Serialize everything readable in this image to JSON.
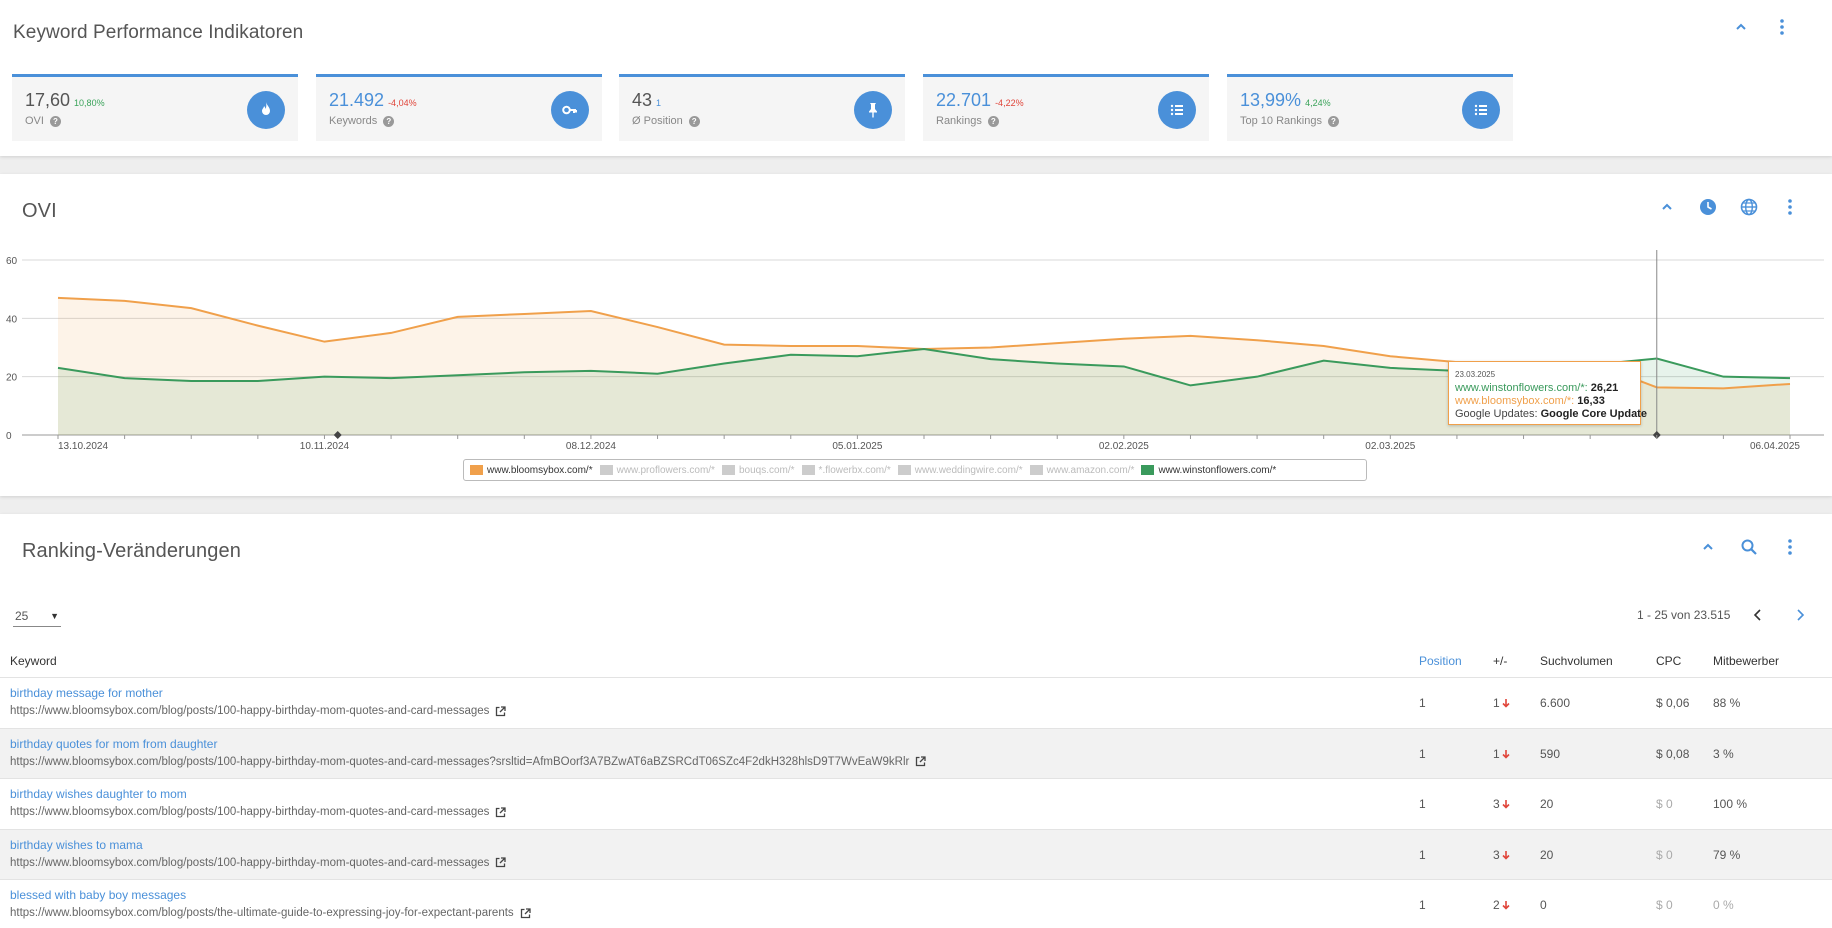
{
  "kpi_section": {
    "title": "Keyword Performance Indikatoren",
    "cards": [
      {
        "value": "17,60",
        "change": "10,80%",
        "change_type": "pos",
        "label": "OVI",
        "icon": "flame-icon",
        "value_blue": false
      },
      {
        "value": "21.492",
        "change": "-4,04%",
        "change_type": "neg",
        "label": "Keywords",
        "icon": "key-icon",
        "value_blue": true
      },
      {
        "value": "43",
        "change": "1",
        "change_type": "blue",
        "label": "Ø Position",
        "icon": "pin-icon",
        "value_blue": false
      },
      {
        "value": "22.701",
        "change": "-4,22%",
        "change_type": "neg",
        "label": "Rankings",
        "icon": "list-icon",
        "value_blue": true
      },
      {
        "value": "13,99%",
        "change": "4,24%",
        "change_type": "pos",
        "label": "Top 10 Rankings",
        "icon": "list-icon",
        "value_blue": true
      }
    ]
  },
  "ovi_section": {
    "title": "OVI",
    "tooltip": {
      "date": "23.03.2025",
      "rows": [
        {
          "label": "www.winstonflowers.com/*:",
          "value": "26,21",
          "color": "#3a9a5c"
        },
        {
          "label": "www.bloomsybox.com/*:",
          "value": "16,33",
          "color": "#f0a04b"
        }
      ],
      "update_label": "Google Updates:",
      "update_value": "Google Core Update"
    },
    "legend": [
      {
        "label": "www.bloomsybox.com/*",
        "color": "#f0a04b",
        "active": true
      },
      {
        "label": "www.proflowers.com/*",
        "color": "#cccccc",
        "active": false
      },
      {
        "label": "bouqs.com/*",
        "color": "#cccccc",
        "active": false
      },
      {
        "label": "*.flowerbx.com/*",
        "color": "#cccccc",
        "active": false
      },
      {
        "label": "www.weddingwire.com/*",
        "color": "#cccccc",
        "active": false
      },
      {
        "label": "www.amazon.com/*",
        "color": "#cccccc",
        "active": false
      },
      {
        "label": "www.winstonflowers.com/*",
        "color": "#3a9a5c",
        "active": true
      }
    ]
  },
  "chart_data": {
    "type": "area",
    "title": "OVI",
    "ylim": [
      0,
      60
    ],
    "y_ticks": [
      "0",
      "20",
      "40",
      "60"
    ],
    "x_tick_labels": [
      "13.10.2024",
      "10.11.2024",
      "08.12.2024",
      "05.01.2025",
      "02.02.2025",
      "02.03.2025",
      "06.04.2025"
    ],
    "grid": true,
    "legend_position": "bottom",
    "series": [
      {
        "name": "www.bloomsybox.com/*",
        "color": "#f0a04b",
        "values": [
          47,
          46,
          43.5,
          37.5,
          32,
          35,
          40.5,
          41.5,
          42.5,
          37,
          31,
          30.5,
          30.5,
          29.5,
          30,
          31.5,
          33,
          34,
          32.5,
          30.5,
          27,
          25,
          25,
          25,
          16.33,
          16,
          17.5
        ]
      },
      {
        "name": "www.winstonflowers.com/*",
        "color": "#3a9a5c",
        "values": [
          23,
          19.5,
          18.5,
          18.5,
          20,
          19.5,
          20.5,
          21.5,
          22,
          21,
          24.5,
          27.5,
          27,
          29.5,
          26,
          24.5,
          23.5,
          17,
          20,
          25.5,
          23,
          22,
          23.5,
          24,
          26.21,
          20,
          19.5
        ]
      }
    ]
  },
  "ranking_section": {
    "title": "Ranking-Veränderungen",
    "page_size": "25",
    "pager_info": "1 - 25 von 23.515",
    "headers": {
      "keyword": "Keyword",
      "position": "Position",
      "change": "+/-",
      "volume": "Suchvolumen",
      "cpc": "CPC",
      "competitors": "Mitbewerber"
    },
    "rows": [
      {
        "keyword": "birthday message for mother",
        "url": "https://www.bloomsybox.com/blog/posts/100-happy-birthday-mom-quotes-and-card-messages",
        "position": "1",
        "change": "1",
        "volume": "6.600",
        "cpc": "$ 0,06",
        "cpc_muted": false,
        "competitors": "88 %",
        "comp_muted": false
      },
      {
        "keyword": "birthday quotes for mom from daughter",
        "url": "https://www.bloomsybox.com/blog/posts/100-happy-birthday-mom-quotes-and-card-messages?srsltid=AfmBOorf3A7BZwAT6aBZSRCdT06SZc4F2dkH328hlsD9T7WvEaW9kRlr",
        "position": "1",
        "change": "1",
        "volume": "590",
        "cpc": "$ 0,08",
        "cpc_muted": false,
        "competitors": "3 %",
        "comp_muted": false
      },
      {
        "keyword": "birthday wishes daughter to mom",
        "url": "https://www.bloomsybox.com/blog/posts/100-happy-birthday-mom-quotes-and-card-messages",
        "position": "1",
        "change": "3",
        "volume": "20",
        "cpc": "$ 0",
        "cpc_muted": true,
        "competitors": "100 %",
        "comp_muted": false
      },
      {
        "keyword": "birthday wishes to mama",
        "url": "https://www.bloomsybox.com/blog/posts/100-happy-birthday-mom-quotes-and-card-messages",
        "position": "1",
        "change": "3",
        "volume": "20",
        "cpc": "$ 0",
        "cpc_muted": true,
        "competitors": "79 %",
        "comp_muted": false
      },
      {
        "keyword": "blessed with baby boy messages",
        "url": "https://www.bloomsybox.com/blog/posts/the-ultimate-guide-to-expressing-joy-for-expectant-parents",
        "position": "1",
        "change": "2",
        "volume": "0",
        "cpc": "$ 0",
        "cpc_muted": true,
        "competitors": "0 %",
        "comp_muted": true
      }
    ]
  },
  "colors": {
    "accent": "#4a90d9",
    "orange": "#f0a04b",
    "green": "#3a9a5c",
    "negative": "#e0453a"
  }
}
